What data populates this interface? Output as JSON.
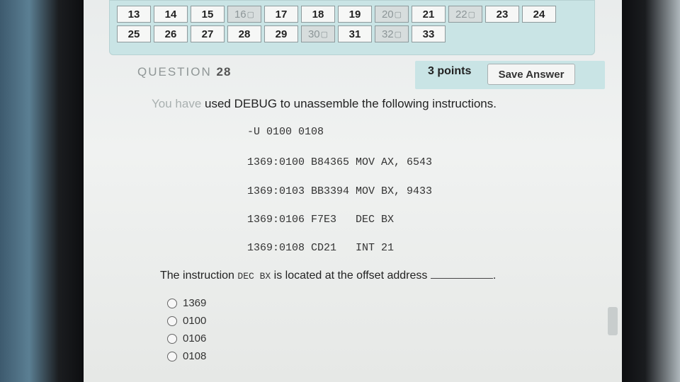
{
  "question_nav": {
    "buttons": [
      {
        "label": "13",
        "answered": false
      },
      {
        "label": "14",
        "answered": false
      },
      {
        "label": "15",
        "answered": false
      },
      {
        "label": "16",
        "answered": true
      },
      {
        "label": "17",
        "answered": false
      },
      {
        "label": "18",
        "answered": false
      },
      {
        "label": "19",
        "answered": false
      },
      {
        "label": "20",
        "answered": true
      },
      {
        "label": "21",
        "answered": false
      },
      {
        "label": "22",
        "answered": true
      },
      {
        "label": "23",
        "answered": false
      },
      {
        "label": "24",
        "answered": false
      },
      {
        "label": "25",
        "answered": false
      },
      {
        "label": "26",
        "answered": false
      },
      {
        "label": "27",
        "answered": false
      },
      {
        "label": "28",
        "answered": false
      },
      {
        "label": "29",
        "answered": false
      },
      {
        "label": "30",
        "answered": true
      },
      {
        "label": "31",
        "answered": false
      },
      {
        "label": "32",
        "answered": true
      },
      {
        "label": "33",
        "answered": false
      }
    ],
    "flag_icon": "answered-flag-icon"
  },
  "question": {
    "label": "QUESTION",
    "number": "28",
    "points": "3 points",
    "save_label": "Save Answer",
    "prompt_faded": "You have",
    "prompt_rest": " used DEBUG to unassemble the following instructions.",
    "code": [
      "-U 0100 0108",
      "1369:0100 B84365 MOV AX, 6543",
      "1369:0103 BB3394 MOV BX, 9433",
      "1369:0106 F7E3   DEC BX",
      "1369:0108 CD21   INT 21"
    ],
    "stem_before": "The instruction ",
    "stem_code": "DEC BX",
    "stem_after": " is located at the offset address ",
    "stem_end": ".",
    "options": [
      "1369",
      "0100",
      "0106",
      "0108"
    ]
  },
  "colors": {
    "panel": "#c9e4e5",
    "screen": "#eceeed"
  }
}
